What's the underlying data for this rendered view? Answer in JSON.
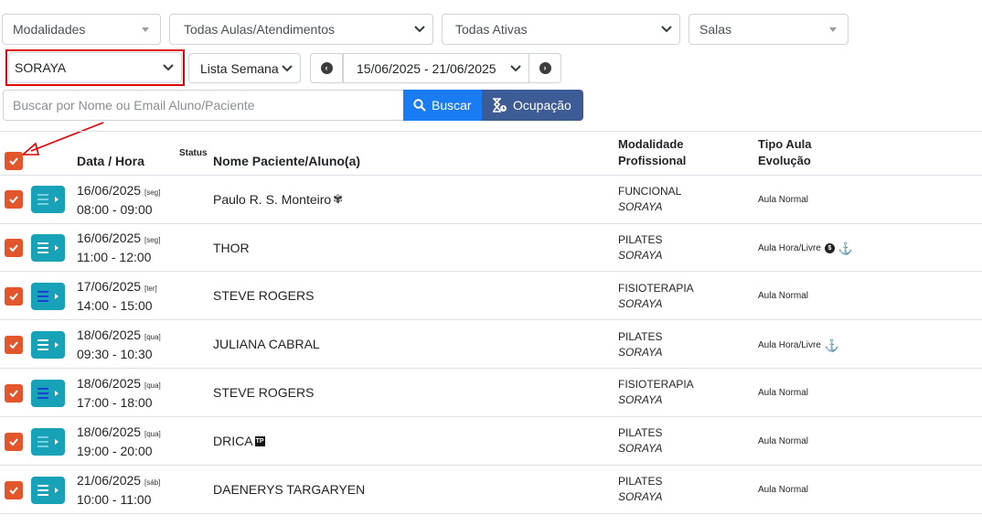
{
  "filters": {
    "modalidades": "Modalidades",
    "aulas": "Todas Aulas/Atendimentos",
    "ativas": "Todas Ativas",
    "salas": "Salas",
    "profissional": "SORAYA",
    "view": "Lista Semana",
    "period": "15/06/2025 - 21/06/2025"
  },
  "search": {
    "placeholder": "Buscar por Nome ou Email Aluno/Paciente",
    "buscar_label": "Buscar",
    "ocupacao_label": "Ocupação"
  },
  "table": {
    "headers": {
      "data_hora": "Data / Hora",
      "status": "Status",
      "nome": "Nome Paciente/Aluno(a)",
      "modalidade": "Modalidade",
      "profissional": "Profissional",
      "tipo_aula": "Tipo Aula",
      "evolucao": "Evolução"
    },
    "rows": [
      {
        "date": "16/06/2025",
        "weekday": "[seg]",
        "time": "08:00 - 09:00",
        "name": "Paulo R. S. Monteiro",
        "modalidade": "FUNCIONAL",
        "profissional": "SORAYA",
        "tipo": "Aula Normal"
      },
      {
        "date": "16/06/2025",
        "weekday": "[seg]",
        "time": "11:00 - 12:00",
        "name": "THOR",
        "modalidade": "PILATES",
        "profissional": "SORAYA",
        "tipo": "Aula Hora/Livre"
      },
      {
        "date": "17/06/2025",
        "weekday": "[ter]",
        "time": "14:00 - 15:00",
        "name": "STEVE ROGERS",
        "modalidade": "FISIOTERAPIA",
        "profissional": "SORAYA",
        "tipo": "Aula Normal"
      },
      {
        "date": "18/06/2025",
        "weekday": "[qua]",
        "time": "09:30 - 10:30",
        "name": "JULIANA CABRAL",
        "modalidade": "PILATES",
        "profissional": "SORAYA",
        "tipo": "Aula Hora/Livre"
      },
      {
        "date": "18/06/2025",
        "weekday": "[qua]",
        "time": "17:00 - 18:00",
        "name": "STEVE ROGERS",
        "modalidade": "FISIOTERAPIA",
        "profissional": "SORAYA",
        "tipo": "Aula Normal"
      },
      {
        "date": "18/06/2025",
        "weekday": "[qua]",
        "time": "19:00 - 20:00",
        "name": "DRICA",
        "modalidade": "PILATES",
        "profissional": "SORAYA",
        "tipo": "Aula Normal"
      },
      {
        "date": "21/06/2025",
        "weekday": "[sáb]",
        "time": "10:00 - 11:00",
        "name": "DAENERYS TARGARYEN",
        "modalidade": "PILATES",
        "profissional": "SORAYA",
        "tipo": "Aula Normal"
      }
    ]
  },
  "colors": {
    "checkbox": "#e3562b",
    "row_button": "#17a2b8",
    "buscar": "#1a7cf2",
    "ocupacao": "#3d5b94",
    "highlight": "#e00000"
  }
}
